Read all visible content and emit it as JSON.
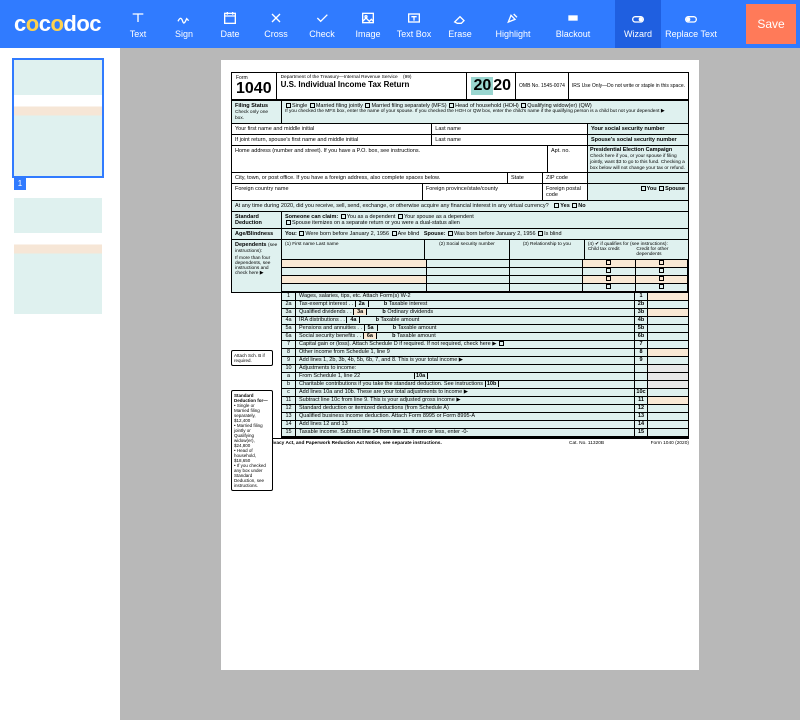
{
  "brand": "cocodoc",
  "toolbar": {
    "text": "Text",
    "sign": "Sign",
    "date": "Date",
    "cross": "Cross",
    "check": "Check",
    "image": "Image",
    "textbox": "Text Box",
    "erase": "Erase",
    "highlight": "Highlight",
    "blackout": "Blackout",
    "wizard": "Wizard",
    "replace": "Replace Text",
    "save": "Save"
  },
  "thumbs": {
    "page1": "1"
  },
  "form": {
    "formWord": "Form",
    "formNum": "1040",
    "dept": "Department of the Treasury—Internal Revenue Service",
    "ret99": "(99)",
    "title": "U.S. Individual Income Tax Return",
    "year_a": "20",
    "year_b": "20",
    "omb": "OMB No. 1545-0074",
    "irs": "IRS Use Only—Do not write or staple in this space.",
    "filing": {
      "label1": "Filing Status",
      "label2": "Check only one box.",
      "single": "Single",
      "mfj": "Married filing jointly",
      "mfs": "Married filing separately (MFS)",
      "hoh": "Head of household (HOH)",
      "qw": "Qualifying widow(er) (QW)",
      "mfs_note": "If you checked the MFS box, enter the name of your spouse. If you checked the HOH or QW box, enter the child's name if the qualifying person is a child but not your dependent ▶"
    },
    "name": {
      "first": "Your first name and middle initial",
      "last": "Last name",
      "ssn": "Your social security number",
      "sp_first": "If joint return, spouse's first name and middle initial",
      "sp_last": "Last name",
      "sp_ssn": "Spouse's social security number",
      "address": "Home address (number and street). If you have a P.O. box, see instructions.",
      "apt": "Apt. no.",
      "city": "City, town, or post office. If you have a foreign address, also complete spaces below.",
      "state": "State",
      "zip": "ZIP code",
      "fc": "Foreign country name",
      "fp": "Foreign province/state/county",
      "fpc": "Foreign postal code",
      "pec_title": "Presidential Election Campaign",
      "pec_text": "Check here if you, or your spouse if filing jointly, want $3 to go to this fund. Checking a box below will not change your tax or refund.",
      "pec_you": "You",
      "pec_sp": "Spouse"
    },
    "crypto": "At any time during 2020, did you receive, sell, send, exchange, or otherwise acquire any financial interest in any virtual currency?",
    "yes": "Yes",
    "no": "No",
    "std": {
      "label": "Standard Deduction",
      "claim": "Someone can claim:",
      "youdep": "You as a dependent",
      "spdep": "Your spouse as a dependent",
      "itemize": "Spouse itemizes on a separate return or you were a dual-status alien"
    },
    "age": {
      "label": "Age/Blindness",
      "you": "You:",
      "you_born": "Were born before January 2, 1956",
      "blind": "Are blind",
      "spouse": "Spouse:",
      "sp_born": "Was born before January 2, 1956",
      "sp_blind": "Is blind"
    },
    "deps": {
      "label": "Dependents",
      "see": "(see instructions):",
      "col1": "(1) First name          Last name",
      "col2": "(2) Social security number",
      "col3": "(3) Relationship to you",
      "col4a": "(4) ✔ if qualifies for (see instructions):",
      "col4b": "Child tax credit",
      "col4c": "Credit for other dependents",
      "more": "If more than four dependents, see instructions and check here ▶"
    },
    "sidenote1": "Attach Sch. B if required.",
    "sidenote2": {
      "h": "Standard Deduction for—",
      "a": "• Single or Married filing separately, $12,400",
      "b": "• Married filing jointly or Qualifying widow(er), $24,800",
      "c": "• Head of household, $18,650",
      "d": "• If you checked any box under Standard Deduction, see instructions."
    },
    "lines": {
      "l1": "Wages, salaries, tips, etc. Attach Form(s) W-2",
      "l2a": "Tax-exempt interest",
      "l2b": "Taxable interest",
      "l3a": "Qualified dividends",
      "l3b": "Ordinary dividends",
      "l4a": "IRA distributions",
      "l4b": "Taxable amount",
      "l5a": "Pensions and annuities",
      "l5b": "Taxable amount",
      "l6a": "Social security benefits",
      "l6b": "Taxable amount",
      "l7": "Capital gain or (loss). Attach Schedule D if required. If not required, check here",
      "l8": "Other income from Schedule 1, line 9",
      "l9": "Add lines 1, 2b, 3b, 4b, 5b, 6b, 7, and 8. This is your total income",
      "l10": "Adjustments to income:",
      "l10a": "From Schedule 1, line 22",
      "l10b": "Charitable contributions if you take the standard deduction. See instructions",
      "l10c": "Add lines 10a and 10b. These are your total adjustments to income",
      "l11": "Subtract line 10c from line 9. This is your adjusted gross income",
      "l12": "Standard deduction or itemized deductions (from Schedule A)",
      "l13": "Qualified business income deduction. Attach Form 8995 or Form 8995-A",
      "l14": "Add lines 12 and 13",
      "l15": "Taxable income. Subtract line 14 from line 11. If zero or less, enter -0-"
    },
    "footer": {
      "disc": "For Disclosure, Privacy Act, and Paperwork Reduction Act Notice, see separate instructions.",
      "cat": "Cat. No. 11320B",
      "fn": "Form 1040 (2020)"
    }
  }
}
